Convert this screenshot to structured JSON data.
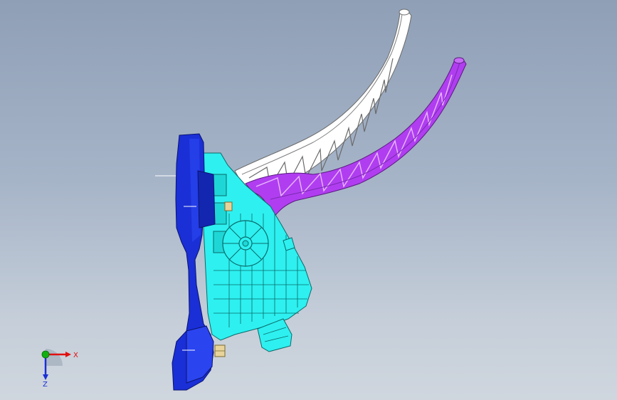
{
  "viewport": {
    "background_top": "#8f9fb6",
    "background_bottom": "#cfd6de"
  },
  "model": {
    "colors": {
      "mount_bracket": "#1a2fd6",
      "housing": "#2ef0f0",
      "pedal_arm_white": "#ffffff",
      "pedal_arm_purple": "#b03ef0",
      "fastener": "#e8d49a"
    }
  },
  "triad": {
    "x_label": "X",
    "y_label": "Y",
    "z_label": "Z",
    "x_color": "#e01010",
    "y_color": "#10b010",
    "z_color": "#1a2fd6"
  }
}
